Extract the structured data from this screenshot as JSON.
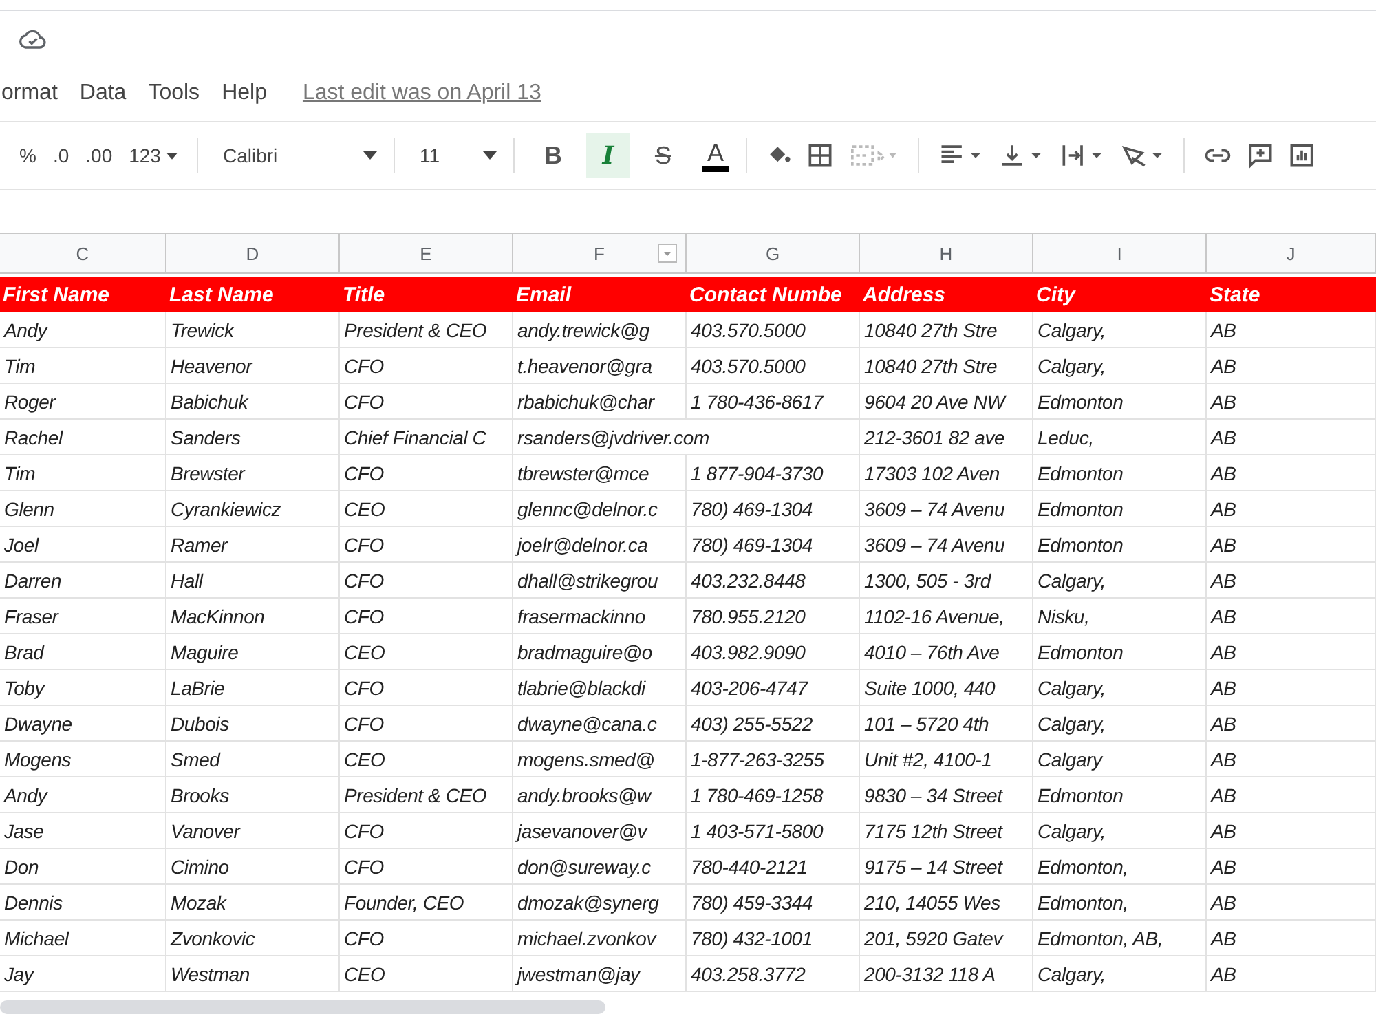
{
  "menu": [
    "ormat",
    "Data",
    "Tools",
    "Help"
  ],
  "last_edit": "Last edit was on April 13",
  "toolbar": {
    "percent": "%",
    "decimal_decrease": ".0",
    "decimal_increase": ".00",
    "number_format": "123",
    "font": "Calibri",
    "font_size": "11",
    "styles": [
      {
        "kind": "bold",
        "label": "B",
        "selected": false
      },
      {
        "kind": "italic",
        "label": "I",
        "selected": true
      },
      {
        "kind": "strike",
        "label": "S",
        "selected": false
      }
    ],
    "text_color": "A",
    "merge_disabled": true
  },
  "column_letters": [
    {
      "letter": "C",
      "filter": false
    },
    {
      "letter": "D",
      "filter": false
    },
    {
      "letter": "E",
      "filter": false
    },
    {
      "letter": "F",
      "filter": true
    },
    {
      "letter": "G",
      "filter": false
    },
    {
      "letter": "H",
      "filter": false
    },
    {
      "letter": "I",
      "filter": false
    },
    {
      "letter": "J",
      "filter": false
    }
  ],
  "table": {
    "columns": [
      "First Name",
      "Last Name",
      "Title",
      "Email",
      "Contact Numbe",
      "Address",
      "City",
      "State"
    ],
    "rows": [
      [
        "Andy",
        "Trewick",
        "President & CEO",
        "andy.trewick@g",
        "403.570.5000",
        "10840 27th Stre",
        "Calgary,",
        "AB"
      ],
      [
        "Tim",
        "Heavenor",
        "CFO",
        "t.heavenor@gra",
        "403.570.5000",
        "10840 27th Stre",
        "Calgary,",
        "AB"
      ],
      [
        "Roger",
        "Babichuk",
        "CFO",
        "rbabichuk@char",
        "1 780-436-8617",
        "9604 20 Ave NW",
        "Edmonton",
        "AB"
      ],
      [
        "Rachel",
        "Sanders",
        "Chief Financial C",
        "rsanders@jvdriver.com",
        "",
        "212-3601 82 ave",
        "Leduc,",
        "AB"
      ],
      [
        "Tim",
        "Brewster",
        "CFO",
        "tbrewster@mce",
        "1 877-904-3730",
        "17303 102 Aven",
        "Edmonton",
        "AB"
      ],
      [
        "Glenn",
        "Cyrankiewicz",
        "CEO",
        "glennc@delnor.c",
        "780) 469-1304",
        "3609 – 74 Avenu",
        "Edmonton",
        "AB"
      ],
      [
        "Joel",
        "Ramer",
        "CFO",
        "joelr@delnor.ca",
        "780) 469-1304",
        "3609 – 74 Avenu",
        "Edmonton",
        "AB"
      ],
      [
        "Darren",
        "Hall",
        "CFO",
        "dhall@strikegrou",
        "403.232.8448",
        "1300, 505 - 3rd",
        "Calgary,",
        "AB"
      ],
      [
        "Fraser",
        "MacKinnon",
        "CFO",
        "frasermackinno",
        "780.955.2120",
        "1102-16 Avenue,",
        "Nisku,",
        "AB"
      ],
      [
        "Brad",
        "Maguire",
        "CEO",
        "bradmaguire@o",
        "403.982.9090",
        "4010 – 76th Ave",
        "Edmonton",
        "AB"
      ],
      [
        "Toby",
        "LaBrie",
        "CFO",
        "tlabrie@blackdi",
        "403-206-4747",
        "Suite 1000, 440",
        "Calgary,",
        "AB"
      ],
      [
        "Dwayne",
        "Dubois",
        "CFO",
        "dwayne@cana.c",
        "403) 255-5522",
        "101 – 5720 4th",
        "Calgary,",
        "AB"
      ],
      [
        "Mogens",
        "Smed",
        "CEO",
        "mogens.smed@",
        "1-877-263-3255",
        "Unit #2, 4100-1",
        "Calgary",
        "AB"
      ],
      [
        "Andy",
        "Brooks",
        "President & CEO",
        "andy.brooks@w",
        "1 780-469-1258",
        "9830 – 34 Street",
        "Edmonton",
        "AB"
      ],
      [
        "Jase",
        "Vanover",
        "CFO",
        "jasevanover@v",
        "1 403-571-5800",
        "7175 12th Street",
        "Calgary,",
        "AB"
      ],
      [
        "Don",
        "Cimino",
        "CFO",
        "don@sureway.c",
        "780-440-2121",
        "9175 – 14 Street",
        "Edmonton,",
        "AB"
      ],
      [
        "Dennis",
        "Mozak",
        "Founder, CEO",
        "dmozak@synerg",
        "780) 459-3344",
        "210, 14055 Wes",
        "Edmonton,",
        "AB"
      ],
      [
        "Michael",
        "Zvonkovic",
        "CFO",
        "michael.zvonkov",
        "780) 432-1001",
        "201, 5920 Gatev",
        "Edmonton, AB,",
        "AB"
      ],
      [
        "Jay",
        "Westman",
        "CEO",
        "jwestman@jay",
        "403.258.3772",
        "200-3132 118 A",
        "Calgary,",
        "AB"
      ]
    ]
  }
}
